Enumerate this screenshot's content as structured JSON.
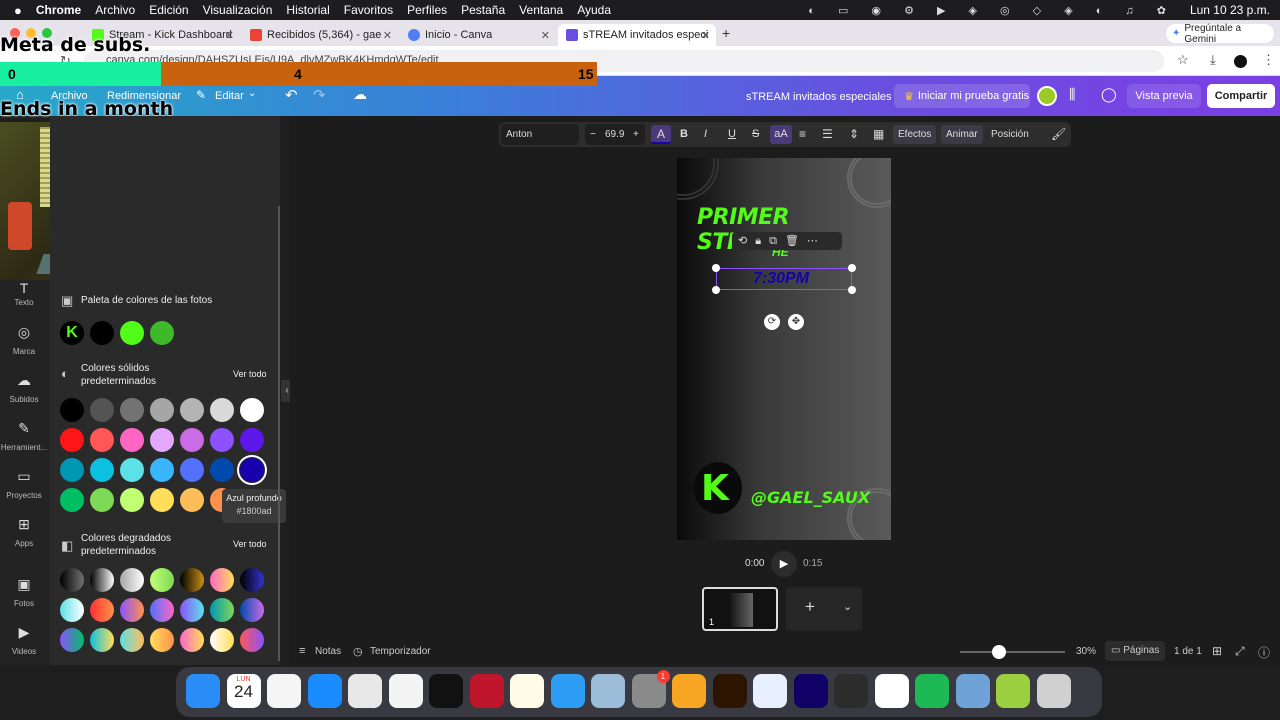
{
  "menubar": {
    "app": "Chrome",
    "items": [
      "Archivo",
      "Edición",
      "Visualización",
      "Historial",
      "Favoritos",
      "Perfiles",
      "Pestaña",
      "Ventana",
      "Ayuda"
    ],
    "clock": "Lun 10 23 p.m."
  },
  "tabs": [
    {
      "label": "Stream - Kick Dashboard",
      "color": "#53fc18"
    },
    {
      "label": "Recibidos (5,364) - gaelsaux",
      "color": "#ea4335"
    },
    {
      "label": "Inicio - Canva",
      "color": "#4f7df2"
    },
    {
      "label": "sTREAM invitados especiales",
      "color": "#6a4ee0"
    }
  ],
  "gemini": "Pregúntale a Gemini",
  "url": "canva.com/design/DAHSZUsLEjs/U9A_dlvMZwBK4KHmdqWTe/edit",
  "overlay": {
    "meta_title": "Meta de subs.",
    "progress_start": "0",
    "progress_current": "4",
    "progress_goal": "15",
    "progress_fraction": 0.27,
    "ends": "Ends in a month"
  },
  "canva_header": {
    "archivo": "Archivo",
    "redimensionar": "Redimensionar",
    "editar": "Editar",
    "title": "sTREAM invitados especiales",
    "trial": "Iniciar mi prueba gratis",
    "preview": "Vista previa",
    "share": "Compartir"
  },
  "rail": [
    {
      "label": "Texto",
      "icon": "T"
    },
    {
      "label": "Marca",
      "icon": "◎"
    },
    {
      "label": "Subidos",
      "icon": "☁"
    },
    {
      "label": "Herramient...",
      "icon": "✎"
    },
    {
      "label": "Proyectos",
      "icon": "▭"
    },
    {
      "label": "Apps",
      "icon": "⊞"
    },
    {
      "label": "Fotos",
      "icon": "▣"
    },
    {
      "label": "Videos",
      "icon": "▶"
    }
  ],
  "panel": {
    "photo_palette": "Paleta de colores de las fotos",
    "solid_title": "Colores sólidos predeterminados",
    "see_all": "Ver todo",
    "gradient_title": "Colores degradados predeterminados",
    "tooltip_name": "Azul profundo",
    "tooltip_hex": "#1800ad",
    "photo_colors": [
      "#000000",
      "#53fc18",
      "#3fb82a"
    ],
    "solid_colors": [
      [
        "#000000",
        "#545454",
        "#737373",
        "#a6a6a6",
        "#b4b4b4",
        "#d9d9d9",
        "#ffffff"
      ],
      [
        "#ff1616",
        "#ff5757",
        "#ff66c4",
        "#e5a7ff",
        "#cb6ce6",
        "#8c52ff",
        "#5e17eb"
      ],
      [
        "#0097b2",
        "#0cc0df",
        "#5ce1e6",
        "#38b6ff",
        "#5271ff",
        "#004aad",
        "#1800ad"
      ],
      [
        "#00bf63",
        "#7ed957",
        "#c1ff72",
        "#ffde59",
        "#ffbd59",
        "#ff914d",
        ""
      ]
    ],
    "gradients": [
      [
        "#000000,#737373",
        "#000000,#ffffff",
        "#a6a6a6,#ffffff",
        "#c1ff72,#7ed957",
        "#000000,#c89116",
        "#ff66c4,#ffde59",
        "#000000,#3533cd"
      ],
      [
        "#5de0e6,#ffffff",
        "#ff3131,#ff914d",
        "#8c52ff,#ff914d",
        "#5170ff,#ff66c4",
        "#8c52ff,#5ce1e6",
        "#0097b2,#7ed957",
        "#004aad,#cb6ce6"
      ],
      [
        "#8c52ff,#00bf63",
        "#0cc0df,#ffde59",
        "#5de0e6,#ffbd59",
        "#ffde59,#ff914d",
        "#ff66c4,#ffde59",
        "#ffffff,#ffde59",
        "#ff5757,#8c52ff"
      ]
    ]
  },
  "toolbar": {
    "font": "Anton",
    "minus": "−",
    "size": "69.9",
    "plus": "+",
    "letter_a": "A",
    "bold": "B",
    "italic": "I",
    "underline": "U",
    "strike": "S",
    "case": "aA",
    "effects": "Efectos",
    "animate": "Animar",
    "position": "Posición"
  },
  "design": {
    "headline": "PRIMER STREAM",
    "sub": "HE",
    "time": "7:30PM",
    "handle": "@GAEL_SAUX",
    "k_logo": "K"
  },
  "timeline": {
    "current": "0:00",
    "total": "0:15",
    "page_num": "1"
  },
  "footer": {
    "notes": "Notas",
    "timer": "Temporizador",
    "zoom": "30%",
    "zoom_level": 0.3,
    "pages": "Páginas",
    "page_count": "1 de 1"
  },
  "dock": {
    "calendar_month": "LUN",
    "calendar_day": "24",
    "badge": "1",
    "apps": [
      "finder-icon",
      "calendar-icon",
      "reminders-icon",
      "safari-icon",
      "launchpad-icon",
      "photos-icon",
      "capcut-icon",
      "creative-cloud-icon",
      "notes-icon",
      "app-store-icon",
      "preview-icon",
      "system-settings-icon",
      "pages-icon",
      "illustrator-icon",
      "bitwarden-icon",
      "premiere-icon",
      "obs-icon",
      "chrome-icon",
      "spotify-icon",
      "disk-icon",
      "ram-icon",
      "trash-icon"
    ],
    "colors": [
      "#2a8cf7",
      "#ffffff",
      "#f5f5f5",
      "#1a8cff",
      "#e8e8e8",
      "#f4f4f4",
      "#111111",
      "#c0162c",
      "#fffbe6",
      "#2c9cf5",
      "#9bbcd8",
      "#8a8a8a",
      "#f6a623",
      "#2b1400",
      "#e8f0ff",
      "#110066",
      "#2c2c2c",
      "#ffffff",
      "#1db954",
      "#6fa3d8",
      "#9ccf3f",
      "#d0d0d0"
    ]
  }
}
